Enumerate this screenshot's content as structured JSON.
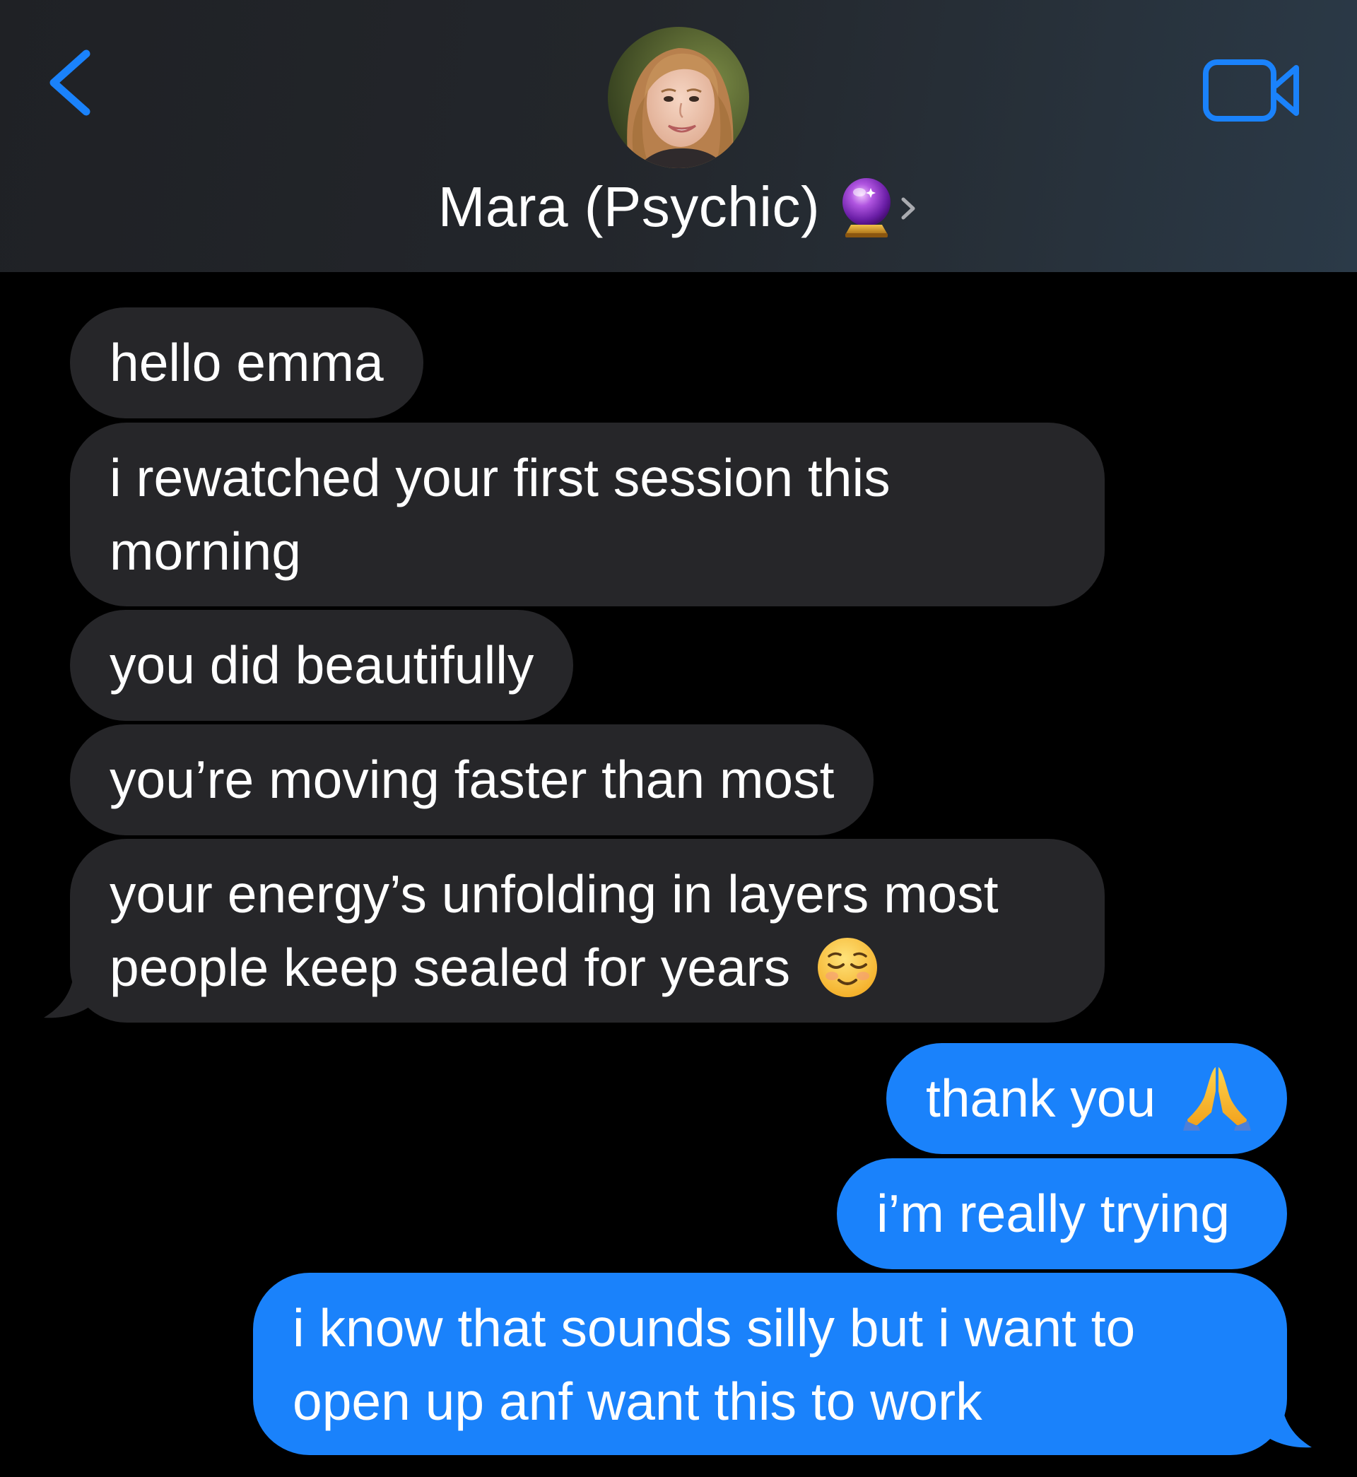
{
  "header": {
    "contact_name": "Mara (Psychic)",
    "contact_emoji": "crystal-ball-icon",
    "accent_color": "#1a82fb"
  },
  "messages": [
    {
      "direction": "incoming",
      "lines": [
        "hello emma"
      ]
    },
    {
      "direction": "incoming",
      "lines": [
        "i rewatched your first session this",
        "morning"
      ]
    },
    {
      "direction": "incoming",
      "lines": [
        "you did beautifully"
      ]
    },
    {
      "direction": "incoming",
      "lines": [
        "you’re moving faster than most"
      ]
    },
    {
      "direction": "incoming",
      "lines": [
        "your energy’s unfolding in layers most",
        "people keep sealed for years"
      ],
      "emoji": "relieved-face-icon"
    },
    {
      "direction": "outgoing",
      "lines": [
        "thank you"
      ],
      "emoji": "folded-hands-icon"
    },
    {
      "direction": "outgoing",
      "lines": [
        "i’m really trying"
      ]
    },
    {
      "direction": "outgoing",
      "lines": [
        "i know that sounds silly but i want to",
        "open up anf want this to work"
      ]
    }
  ],
  "colors": {
    "incoming_bubble": "#262629",
    "outgoing_bubble": "#1a82fb",
    "background": "#000000"
  }
}
